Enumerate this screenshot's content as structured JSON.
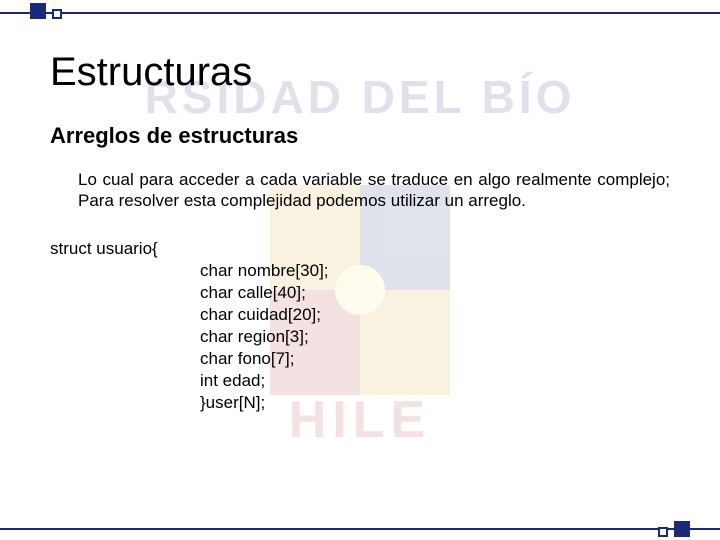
{
  "watermark": {
    "top_text": "RSIDAD DEL BÍO",
    "bottom_text": "HILE"
  },
  "title": "Estructuras",
  "subtitle": "Arreglos de estructuras",
  "paragraph": "Lo cual para acceder a cada variable se traduce en algo realmente complejo; Para resolver esta complejidad podemos utilizar un arreglo.",
  "code": {
    "l0": "struct usuario{",
    "l1": "char nombre[30];",
    "l2": "char calle[40];",
    "l3": "char cuidad[20];",
    "l4": "char region[3];",
    "l5": "char fono[7];",
    "l6": "int edad;",
    "l7": "}user[N];"
  }
}
